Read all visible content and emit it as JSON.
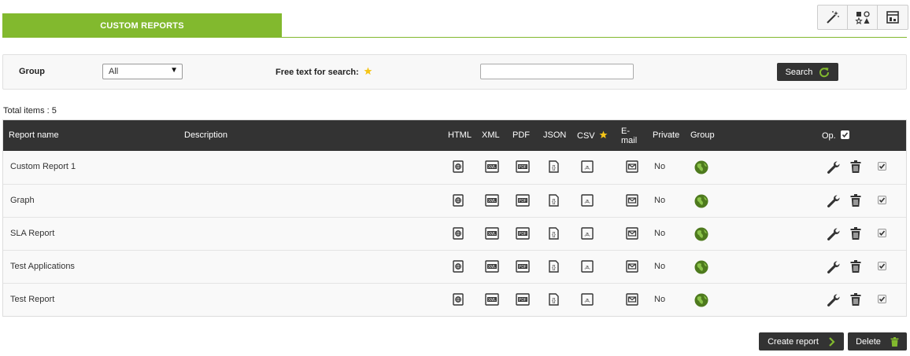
{
  "header": {
    "tab_label": "CUSTOM REPORTS"
  },
  "toolbar": {
    "icons": [
      "magic-wand-icon",
      "shapes-icon",
      "report-icon"
    ]
  },
  "filter": {
    "group_label": "Group",
    "group_value": "All",
    "search_label": "Free text for search:",
    "search_value": "",
    "search_button": "Search"
  },
  "summary": {
    "total_text": "Total items : 5"
  },
  "table": {
    "columns": {
      "name": "Report name",
      "description": "Description",
      "html": "HTML",
      "xml": "XML",
      "pdf": "PDF",
      "json": "JSON",
      "csv": "CSV",
      "email": "E-\nmail",
      "private": "Private",
      "group": "Group",
      "op": "Op."
    },
    "rows": [
      {
        "name": "Custom Report 1",
        "description": "",
        "private": "No"
      },
      {
        "name": "Graph",
        "description": "",
        "private": "No"
      },
      {
        "name": "SLA Report",
        "description": "",
        "private": "No"
      },
      {
        "name": "Test Applications",
        "description": "",
        "private": "No"
      },
      {
        "name": "Test Report",
        "description": "",
        "private": "No"
      }
    ]
  },
  "actions": {
    "create_label": "Create report",
    "delete_label": "Delete"
  },
  "colors": {
    "accent": "#82b92e",
    "dark": "#333333",
    "star": "#f5c518"
  }
}
